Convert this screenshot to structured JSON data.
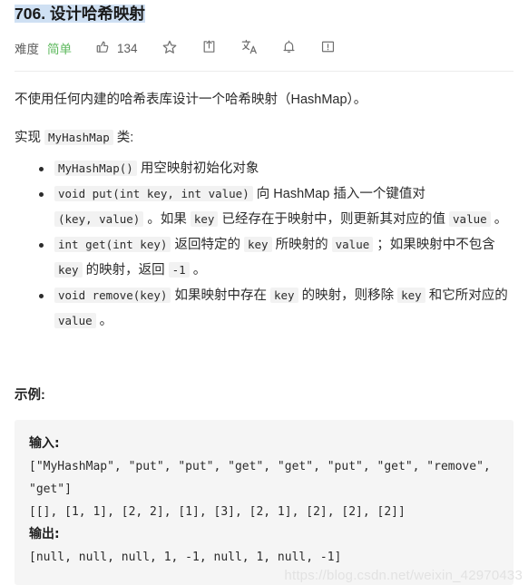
{
  "problem": {
    "title": "706. 设计哈希映射"
  },
  "meta": {
    "difficulty_label": "难度",
    "difficulty_value": "简单",
    "difficulty_color": "#5cb85c",
    "like_count": "134",
    "icons": {
      "like": "thumbs-up-icon",
      "favorite": "star-icon",
      "share": "share-icon",
      "translate": "translate-icon",
      "subscribe": "bell-icon",
      "report": "report-icon"
    }
  },
  "description": {
    "line1": "不使用任何内建的哈希表库设计一个哈希映射（HashMap）。",
    "impl_prefix": "实现",
    "impl_code": "MyHashMap",
    "impl_suffix": "类:"
  },
  "spec_items": [
    {
      "parts": [
        {
          "type": "code",
          "text": "MyHashMap()"
        },
        {
          "type": "text",
          "text": "用空映射初始化对象"
        }
      ]
    },
    {
      "parts": [
        {
          "type": "code",
          "text": "void put(int key, int value)"
        },
        {
          "type": "text",
          "text": "向 HashMap 插入一个键值对"
        },
        {
          "type": "code",
          "text": "(key, value)"
        },
        {
          "type": "text",
          "text": "。如果"
        },
        {
          "type": "code",
          "text": "key"
        },
        {
          "type": "text",
          "text": "已经存在于映射中，则更新其对应的值"
        },
        {
          "type": "code",
          "text": "value"
        },
        {
          "type": "text",
          "text": "。"
        }
      ]
    },
    {
      "parts": [
        {
          "type": "code",
          "text": "int get(int key)"
        },
        {
          "type": "text",
          "text": "返回特定的"
        },
        {
          "type": "code",
          "text": "key"
        },
        {
          "type": "text",
          "text": "所映射的"
        },
        {
          "type": "code",
          "text": "value"
        },
        {
          "type": "text",
          "text": "；如果映射中不包含"
        },
        {
          "type": "code",
          "text": "key"
        },
        {
          "type": "text",
          "text": "的映射，返回"
        },
        {
          "type": "code",
          "text": "-1"
        },
        {
          "type": "text",
          "text": "。"
        }
      ]
    },
    {
      "parts": [
        {
          "type": "code",
          "text": "void remove(key)"
        },
        {
          "type": "text",
          "text": "如果映射中存在"
        },
        {
          "type": "code",
          "text": "key"
        },
        {
          "type": "text",
          "text": "的映射，则移除"
        },
        {
          "type": "code",
          "text": "key"
        },
        {
          "type": "text",
          "text": "和它所对应的"
        },
        {
          "type": "code",
          "text": "value"
        },
        {
          "type": "text",
          "text": "。"
        }
      ]
    }
  ],
  "example": {
    "heading": "示例:",
    "input_label": "输入:",
    "input_lines": [
      "[\"MyHashMap\", \"put\", \"put\", \"get\", \"get\", \"put\", \"get\", \"remove\", \"get\"]",
      "[[], [1, 1], [2, 2], [1], [3], [2, 1], [2], [2], [2]]"
    ],
    "output_label": "输出:",
    "output_lines": [
      "[null, null, null, 1, -1, null, 1, null, -1]"
    ]
  },
  "watermark": {
    "text": "https://blog.csdn.net/weixin_42970433"
  }
}
